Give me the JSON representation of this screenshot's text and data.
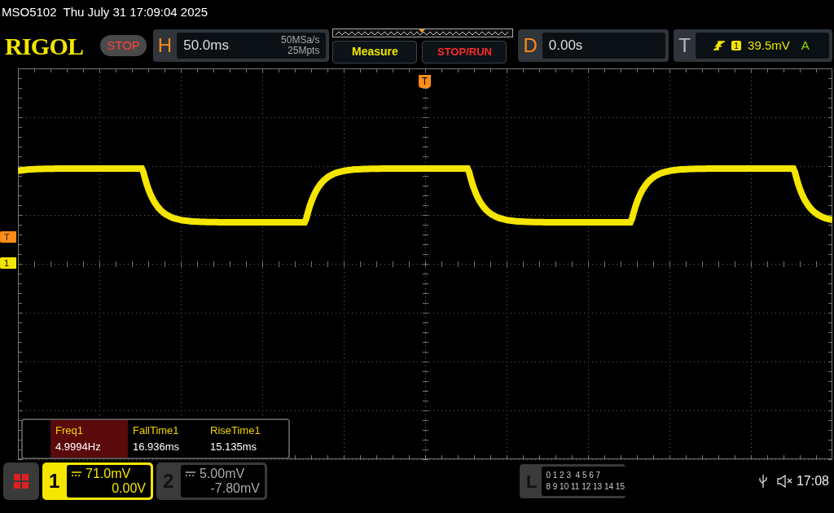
{
  "title_bar": {
    "model": "MSO5102",
    "datetime": "Thu July 31 17:09:04 2025"
  },
  "header": {
    "logo": "RIGOL",
    "run_state": "STOP",
    "horizontal": {
      "label": "H",
      "timebase": "50.0ms",
      "sample_rate": "50MSa/s",
      "memory_depth": "25Mpts"
    },
    "measure_button": "Measure",
    "run_stop_button": "STOP/RUN",
    "delay": {
      "label": "D",
      "value": "0.00s"
    },
    "trigger": {
      "label": "T",
      "source": "1",
      "level": "39.5mV",
      "mode": "A"
    }
  },
  "trigger_position_marker": "T",
  "markers": [
    {
      "kind": "trigger",
      "label": "T"
    },
    {
      "kind": "channel",
      "label": "1"
    }
  ],
  "measurements": [
    {
      "label": "Freq1",
      "value": "4.9994Hz",
      "selected": true
    },
    {
      "label": "FallTime1",
      "value": "16.936ms",
      "selected": false
    },
    {
      "label": "RiseTime1",
      "value": "15.135ms",
      "selected": false
    }
  ],
  "channels": [
    {
      "number": "1",
      "scale": "71.0mV",
      "offset": "0.00V",
      "selected": true
    },
    {
      "number": "2",
      "scale": "5.00mV",
      "offset": "-7.80mV",
      "selected": false
    }
  ],
  "logic": {
    "label": "L",
    "rows": [
      "0 1 2 3  4 5 6 7",
      "8 9 10 11 12 13 14 15"
    ]
  },
  "status": {
    "time": "17:08"
  }
}
